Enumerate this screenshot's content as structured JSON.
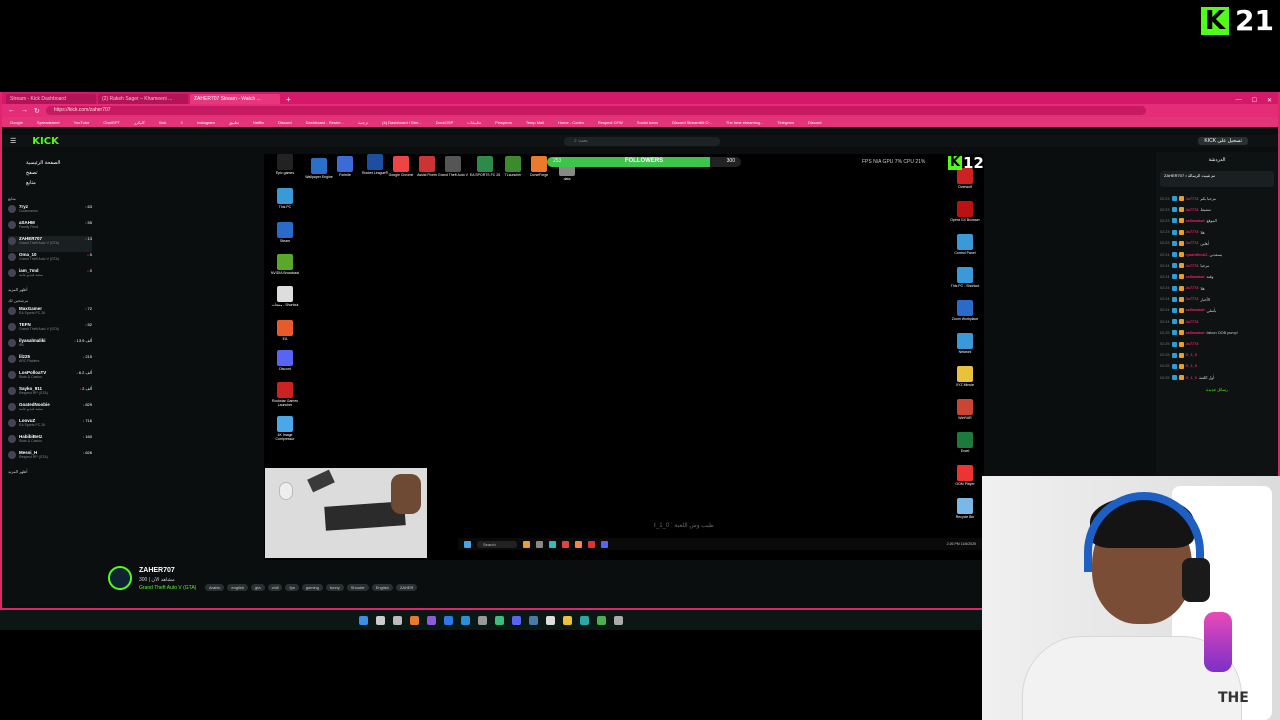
{
  "overlay": {
    "kick_letter": "K",
    "viewer_count": "21"
  },
  "browser": {
    "tabs": [
      "Stream - Kick Dashboard",
      "(2) Rakeh Sager – Khameeni ...",
      "ZAHER707 Stream - Watch ..."
    ],
    "url": "https://kick.com/zaher707",
    "bookmarks": [
      "Google",
      "Spreadsheet",
      "YouTube",
      "ChatGPT",
      "كليكرز",
      "Kick",
      "X",
      "Instagram",
      "تطبيق",
      "Netflix",
      "Discord",
      "Dashboard - Restre...",
      "ترجمة",
      "(4) Dashboard / Stre...",
      "DuckOSP",
      "تطبيقات",
      "Pinspiron",
      "Temp Mail",
      "Home - Codex",
      "Respect CFW",
      "Social icons",
      "Discord StreamKit O...",
      "The best streaming...",
      "Telegram",
      "Discord"
    ]
  },
  "kick": {
    "logo": "KICK",
    "search_placeholder": "بحث",
    "login_button": "KICK تسجيل على",
    "nav": [
      "الصفحة الرئيسية",
      "تصفح",
      "متابع"
    ],
    "section_following": "متابع",
    "section_recommended": "مرشحين لك",
    "show_more": "أظهر المزيد",
    "following": [
      {
        "name": "7ryz",
        "category": "Cookmannn",
        "viewers": "63"
      },
      {
        "name": "aSAHM",
        "category": "Family Feud",
        "viewers": "55"
      },
      {
        "name": "ZAHER707",
        "category": "Grand Theft Auto V (GTA)",
        "viewers": "13"
      },
      {
        "name": "Oma_10",
        "category": "Grand Theft Auto V (GTA)",
        "viewers": "5"
      },
      {
        "name": "iam_7md",
        "category": "منصة فيديو عامة",
        "viewers": "0"
      }
    ],
    "recommended": [
      {
        "name": "MaxGamer",
        "category": "EA Sports FC 26",
        "viewers": "72"
      },
      {
        "name": "TEFN",
        "category": "Grand Theft Auto V (GTA)",
        "viewers": "52"
      },
      {
        "name": "ilyasalmaliki",
        "category": "IRL",
        "viewers": "13.9 ألف"
      },
      {
        "name": "lilz25",
        "category": "ARC Raiders",
        "viewers": "215"
      },
      {
        "name": "LosPolloaTV",
        "category": "Slots & Casino",
        "viewers": "6.2 ألف"
      },
      {
        "name": "Sayko_911",
        "category": "Respect RP (GTA)",
        "viewers": "2 ألف"
      },
      {
        "name": "GoatedNoobie",
        "category": "منصة فيديو عامة",
        "viewers": "829"
      },
      {
        "name": "LoovuZ",
        "category": "EA Sports FC 26",
        "viewers": "716"
      },
      {
        "name": "HabibiBetz",
        "category": "Slots & Casino",
        "viewers": "160"
      },
      {
        "name": "Messi_H",
        "category": "Respect RP (GTA)",
        "viewers": "626"
      }
    ]
  },
  "desktop": {
    "icons_left": [
      "Epic games",
      "Wallpaper Engine",
      "Fortnite",
      "Rocket League®",
      "Google Chrome",
      "Assist Fivem",
      "Grand Theft Auto V",
      "EA SPORTS FC 26",
      "TLauncher",
      "CurseForge",
      "data",
      "This PC",
      "Steam",
      "NVIDIA Broadcast",
      "منتجات - Shortcut",
      "EA",
      "Discord",
      "Rockstar Games Launcher",
      "4K Image Compressor"
    ],
    "icons_right": [
      "Overwolf",
      "Opera GX Browser",
      "Control Panel",
      "This PC - Shortcut",
      "Zoom Workplace",
      "Network",
      "XYZ Minute",
      "WinRAR",
      "Excel",
      "GOM Player",
      "Recycle Bin"
    ],
    "followers_label": "FOLLOWERS",
    "followers_current": "253",
    "followers_goal": "300",
    "followers_fraction": 0.84,
    "fps_text": "FPS N/A   GPU 7%   CPU 21%",
    "viewer_overlay": "12",
    "subtitle": "طيب وش اللعبة : ℓ_1_0",
    "taskbar_search": "Search",
    "clock": "2:26 PM\n11/6/2025"
  },
  "stream": {
    "streamer": "ZAHER707",
    "viewers_line": "300 | مشاهد الآن",
    "category": "Grand Theft Auto V (GTA)",
    "tags": [
      "Arabic",
      "english",
      "gta",
      "chill",
      "fps",
      "gaming",
      "funny",
      "Shooter",
      "English",
      "ZAHER"
    ]
  },
  "chat": {
    "title": "الدردشة",
    "pinned": "ZAHER707 • تم تثبيت الرسالة",
    "messages": [
      {
        "time": "02:23",
        "user": "Jo7773",
        "text": "مرحبا بكم"
      },
      {
        "time": "02:23",
        "user": "Jo7773",
        "text": "تنشيط"
      },
      {
        "time": "02:23",
        "user": "sallmalawi",
        "text": "الموقع"
      },
      {
        "time": "02:23",
        "user": "Jo7773",
        "text": "هلا"
      },
      {
        "time": "02:23",
        "user": "Jo7773",
        "text": "أهلين"
      },
      {
        "time": "02:24",
        "user": "ryaanWmA2",
        "text": "يسعدني"
      },
      {
        "time": "02:24",
        "user": "Jo7773",
        "text": "مرحبا"
      },
      {
        "time": "02:24",
        "user": "sallmalawi",
        "text": "وقته"
      },
      {
        "time": "02:24",
        "user": "Jo7773",
        "text": "هلا"
      },
      {
        "time": "02:24",
        "user": "Jo7773",
        "text": "الأخبار"
      },
      {
        "time": "02:24",
        "user": "sallmalawi",
        "text": "بأسلي"
      },
      {
        "time": "02:24",
        "user": "Jo7773",
        "text": ""
      },
      {
        "time": "02:25",
        "user": "sallmalawi",
        "text": "falcon OOB pump!"
      },
      {
        "time": "02:25",
        "user": "Jo7773",
        "text": ""
      },
      {
        "time": "02:25",
        "user": "O_1_0",
        "text": ""
      },
      {
        "time": "02:25",
        "user": "O_1_0",
        "text": ""
      },
      {
        "time": "02:25",
        "user": "O_1_0",
        "text": "أول اللعبة"
      }
    ],
    "divider": "رسائل جديدة"
  },
  "webcam": {
    "shirt_print": "THE"
  }
}
